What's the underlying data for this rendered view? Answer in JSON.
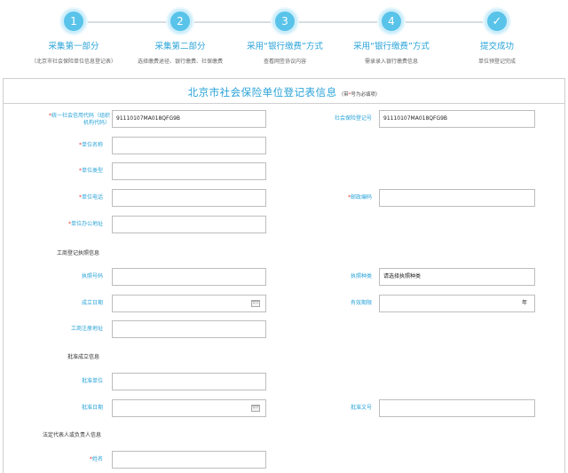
{
  "steps": [
    {
      "num": "1",
      "title": "采集第一部分",
      "desc": "（北京市社会保险单位信息登记表）"
    },
    {
      "num": "2",
      "title": "采集第二部分",
      "desc": "选择缴费途径、银行缴费、社保缴费"
    },
    {
      "num": "3",
      "title": "采用“银行缴费”方式",
      "desc": "查看网签协议内容"
    },
    {
      "num": "4",
      "title": "采用“银行缴费”方式",
      "desc": "需录录入银行缴费信息"
    },
    {
      "num": "",
      "title": "提交成功",
      "desc": "单位预登记完成"
    }
  ],
  "form": {
    "title": "北京市社会保险单位登记表信息",
    "note_prefix": "（带",
    "note_star": "*",
    "note_suffix": "号为必填项）",
    "fields": {
      "credit_code": {
        "label": "统一社会信用代码（组织机构代码）",
        "value": "91110107MA018QFG9B"
      },
      "social_no": {
        "label": "社会保险登记号",
        "value": "91110107MA018QFG9B"
      },
      "unit_name": {
        "label": "单位名称",
        "value": ""
      },
      "unit_type": {
        "label": "单位类型",
        "value": ""
      },
      "unit_phone": {
        "label": "单位电话",
        "value": ""
      },
      "postcode": {
        "label": "邮政编码",
        "value": ""
      },
      "office_addr": {
        "label": "单位办公地址",
        "value": ""
      },
      "license_no": {
        "label": "执照号码",
        "value": ""
      },
      "license_type": {
        "label": "执照种类",
        "value": "请选择执照种类"
      },
      "found_date": {
        "label": "成立日期",
        "value": ""
      },
      "valid_period": {
        "label": "有效期限",
        "value": "",
        "suffix": "年"
      },
      "reg_addr": {
        "label": "工商注册地址",
        "value": ""
      },
      "approve_unit": {
        "label": "批准单位",
        "value": ""
      },
      "approve_date": {
        "label": "批准日期",
        "value": ""
      },
      "approve_doc": {
        "label": "批准文号",
        "value": ""
      },
      "person_name": {
        "label": "姓名",
        "value": ""
      }
    },
    "sections": {
      "business": "工商登记执照信息",
      "approval": "批准成立信息",
      "legal": "法定代表人或负责人信息"
    }
  }
}
